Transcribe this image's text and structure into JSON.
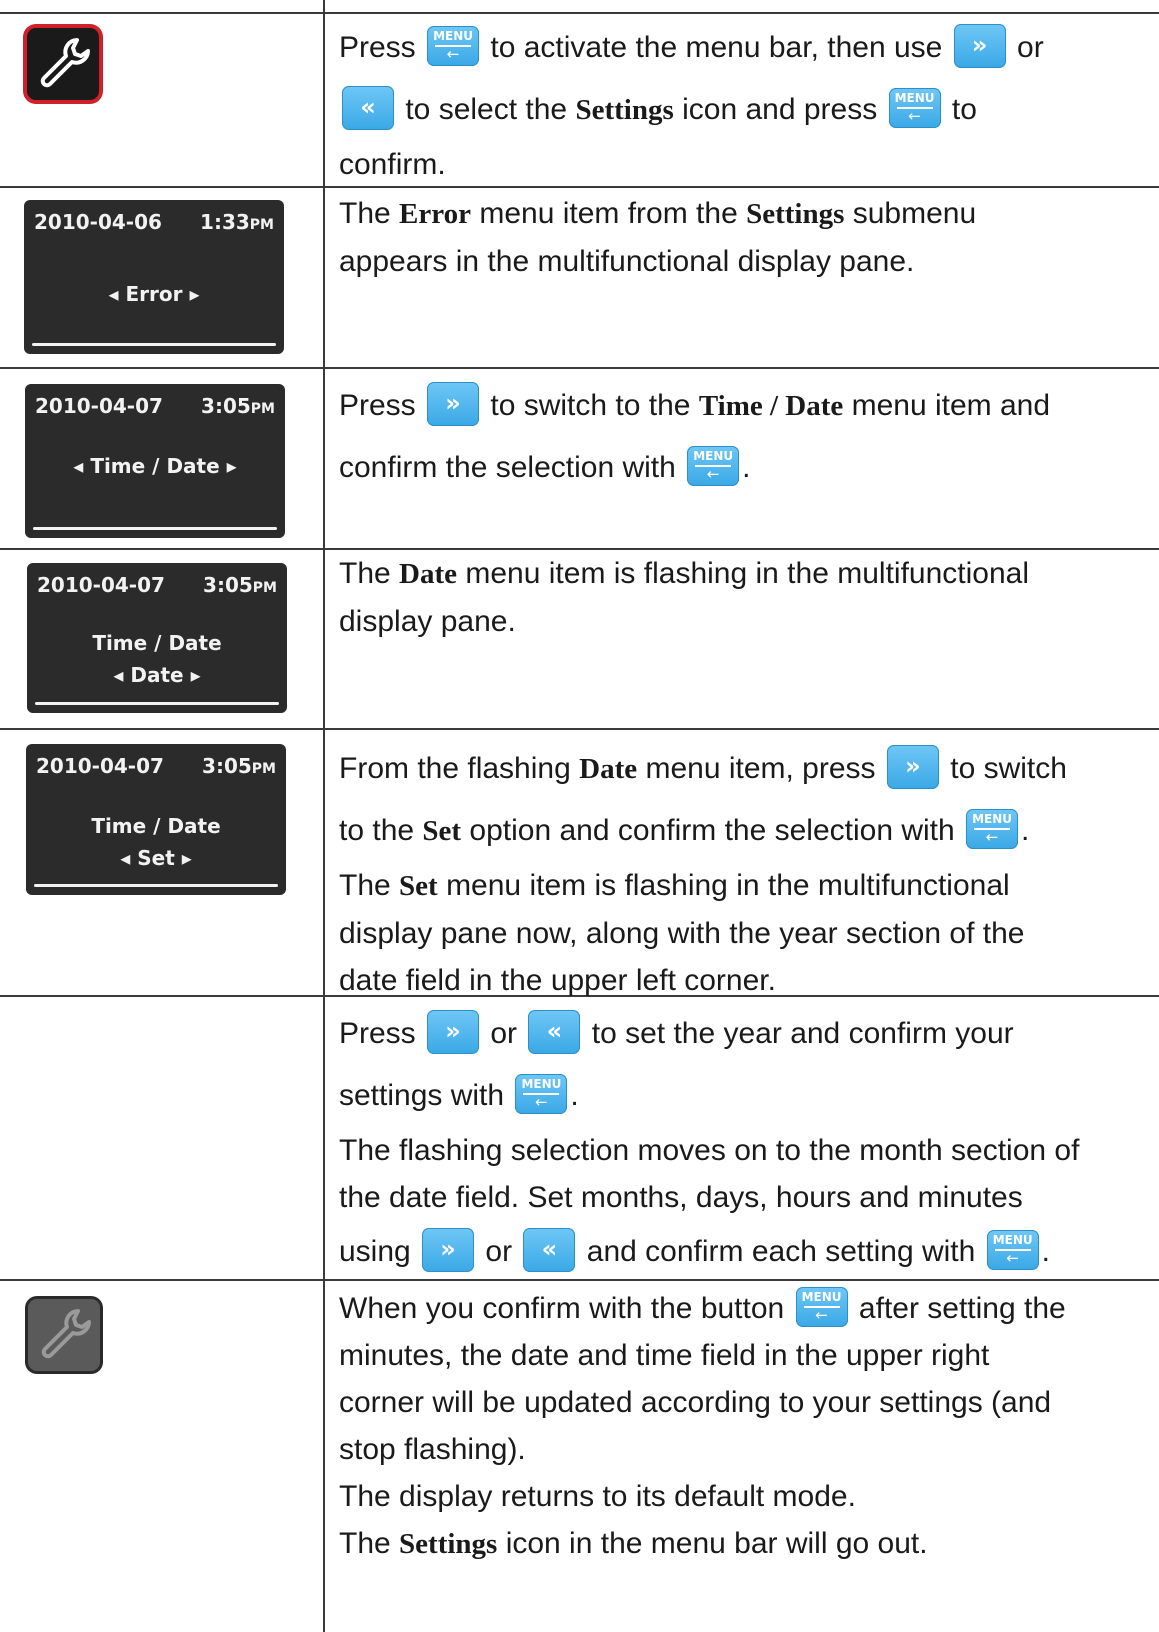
{
  "keys": {
    "menu_top": "MENU",
    "menu_bottom": "←",
    "right_glyph": "»",
    "left_glyph": "«"
  },
  "rows": [
    {
      "icon": "wrench-icon-active",
      "t_press": "Press",
      "t_a": "to activate the menu bar, then use",
      "t_or": "or",
      "t_b": "to select the",
      "t_settings": "Settings",
      "t_c": "icon and press",
      "t_to": "to",
      "t_confirm": "confirm."
    },
    {
      "lcd": {
        "date": "2010-04-06",
        "time": "1:33",
        "ampm": "PM",
        "item": "Error"
      },
      "t_the": "The",
      "t_error": "Error",
      "t_a": "menu item from the",
      "t_settings": "Settings",
      "t_b": "submenu",
      "t_c": "appears in the multifunctional display pane."
    },
    {
      "lcd": {
        "date": "2010-04-07",
        "time": "3:05",
        "ampm": "PM",
        "item": "Time / Date"
      },
      "t_press": "Press",
      "t_a": "to switch to the",
      "t_td": "Time / Date",
      "t_b": "menu item and",
      "t_c": "confirm the selection with",
      "t_dot": "."
    },
    {
      "lcd": {
        "date": "2010-04-07",
        "time": "3:05",
        "ampm": "PM",
        "line1": "Time / Date",
        "item": "Date"
      },
      "t_the": "The",
      "t_date": "Date",
      "t_a": "menu item is flashing in the multifunctional",
      "t_b": "display pane."
    },
    {
      "lcd": {
        "date": "2010-04-07",
        "time": "3:05",
        "ampm": "PM",
        "line1": "Time / Date",
        "item": "Set"
      },
      "t_from": "From the flashing",
      "t_date": "Date",
      "t_a": "menu item, press",
      "t_b": "to switch",
      "t_c": "to the",
      "t_set": "Set",
      "t_d": "option and confirm the selection with",
      "t_dot": ".",
      "t_the": "The",
      "t_set2": "Set",
      "t_e": "menu item is flashing in the multifunctional",
      "t_f": "display pane now, along with the year section of the",
      "t_g": "date field in the upper left corner."
    },
    {
      "t_press": "Press",
      "t_or": "or",
      "t_a": "to set the year and confirm your",
      "t_b": "settings with",
      "t_dot": ".",
      "t_c": "The flashing selection moves on to the month section of",
      "t_d": "the date field. Set months, days, hours and minutes",
      "t_using": "using",
      "t_or2": "or",
      "t_e": "and confirm each setting with",
      "t_dot2": "."
    },
    {
      "icon": "wrench-icon-inactive",
      "t_a": "When you confirm with the button",
      "t_b": "after setting the",
      "t_c": "minutes, the date and time field in the upper right",
      "t_d": "corner will be updated according to your settings (and",
      "t_e": "stop flashing).",
      "t_f": "The display returns to its default mode.",
      "t_the": "The",
      "t_settings": "Settings",
      "t_g": "icon in the menu bar will go out."
    }
  ]
}
